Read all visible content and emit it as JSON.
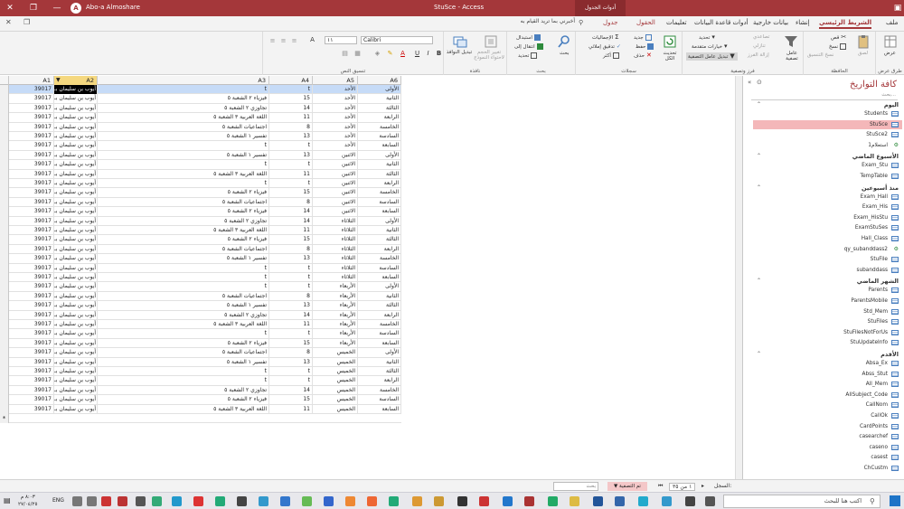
{
  "title": {
    "user": "Abo-a Almoshare",
    "document": "StuSce - Access",
    "context_tab": "أدوات الجدول"
  },
  "tabs": [
    {
      "label": "ملف"
    },
    {
      "label": "الشريط الرئيسي",
      "active": true
    },
    {
      "label": "إنشاء"
    },
    {
      "label": "بيانات خارجية"
    },
    {
      "label": "أدوات قاعدة البيانات"
    },
    {
      "label": "تعليمات"
    },
    {
      "label": "الحقول",
      "context": true
    },
    {
      "label": "جدول",
      "context": true
    }
  ],
  "tell_me": "أخبرني بما تريد القيام به",
  "ribbon": {
    "views": {
      "label": "طرق عرض",
      "view_btn": "عرض"
    },
    "clipboard": {
      "label": "الحافظة",
      "paste": "لصق",
      "cut": "قص",
      "copy": "نسخ",
      "format_painter": "نسخ التنسيق"
    },
    "sort_filter": {
      "label": "فرز وتصفية",
      "filter": "عامل تصفية",
      "ascending": "تصاعدي",
      "descending": "تنازلي",
      "remove_sort": "إزالة الفرز",
      "selection": "تحديد",
      "advanced": "خيارات متقدمة",
      "toggle_filter": "تبديل عامل التصفية"
    },
    "records": {
      "label": "سجلات",
      "refresh": "تحديث الكل",
      "new": "جديد",
      "save": "حفظ",
      "delete": "حذف",
      "totals": "الإجماليات",
      "spelling": "تدقيق إملائي",
      "more": "أكثر"
    },
    "find": {
      "label": "بحث",
      "find": "بحث",
      "replace": "استبدال",
      "goto": "انتقال إلى",
      "select": "تحديد"
    },
    "window": {
      "label": "نافذة",
      "size_to_fit": "تغيير الحجم لاحتواء النموذج",
      "switch_windows": "تبديل النوافذ"
    },
    "text_format": {
      "label": "تنسيق النص",
      "font": "Calibri",
      "size": "١١"
    }
  },
  "columns": [
    "A1",
    "A2",
    "A3",
    "A4",
    "A5",
    "A6"
  ],
  "rows": [
    {
      "a1": "39017",
      "a2": "أيوب بن سليمان بـ",
      "a3": "t",
      "a4": "t",
      "a5": "الأحد",
      "a6": "الأولى"
    },
    {
      "a1": "39017",
      "a2": "أيوب بن سليمان بـ",
      "a3": "فيزياء ٢ الشعبة ٥",
      "a4": "15",
      "a5": "الأحد",
      "a6": "الثانية"
    },
    {
      "a1": "39017",
      "a2": "أيوب بن سليمان بـ",
      "a3": "تجاوزي ٢ الشعبة ٥",
      "a4": "14",
      "a5": "الأحد",
      "a6": "الثالثة"
    },
    {
      "a1": "39017",
      "a2": "أيوب بن سليمان بـ",
      "a3": "اللغة العربية ٣ الشعبة ٥",
      "a4": "11",
      "a5": "الأحد",
      "a6": "الرابعة"
    },
    {
      "a1": "39017",
      "a2": "أيوب بن سليمان بـ",
      "a3": "اجتماعيات الشعبة ٥",
      "a4": "8",
      "a5": "الأحد",
      "a6": "الخامسة"
    },
    {
      "a1": "39017",
      "a2": "أيوب بن سليمان بـ",
      "a3": "تفسير ١ الشعبة ٥",
      "a4": "13",
      "a5": "الأحد",
      "a6": "السادسة"
    },
    {
      "a1": "39017",
      "a2": "أيوب بن سليمان بـ",
      "a3": "t",
      "a4": "t",
      "a5": "الأحد",
      "a6": "السابعة"
    },
    {
      "a1": "39017",
      "a2": "أيوب بن سليمان بـ",
      "a3": "تفسير ١ الشعبة ٥",
      "a4": "13",
      "a5": "الاثنين",
      "a6": "الأولى"
    },
    {
      "a1": "39017",
      "a2": "أيوب بن سليمان بـ",
      "a3": "t",
      "a4": "t",
      "a5": "الاثنين",
      "a6": "الثانية"
    },
    {
      "a1": "39017",
      "a2": "أيوب بن سليمان بـ",
      "a3": "اللغة العربية ٣ الشعبة ٥",
      "a4": "11",
      "a5": "الاثنين",
      "a6": "الثالثة"
    },
    {
      "a1": "39017",
      "a2": "أيوب بن سليمان بـ",
      "a3": "t",
      "a4": "t",
      "a5": "الاثنين",
      "a6": "الرابعة"
    },
    {
      "a1": "39017",
      "a2": "أيوب بن سليمان بـ",
      "a3": "فيزياء ٢ الشعبة ٥",
      "a4": "15",
      "a5": "الاثنين",
      "a6": "الخامسة"
    },
    {
      "a1": "39017",
      "a2": "أيوب بن سليمان بـ",
      "a3": "اجتماعيات الشعبة ٥",
      "a4": "8",
      "a5": "الاثنين",
      "a6": "السادسة"
    },
    {
      "a1": "39017",
      "a2": "أيوب بن سليمان بـ",
      "a3": "فيزياء ٢ الشعبة ٥",
      "a4": "14",
      "a5": "الاثنين",
      "a6": "السابعة"
    },
    {
      "a1": "39017",
      "a2": "أيوب بن سليمان بـ",
      "a3": "تجاوزي ٢ الشعبة ٥",
      "a4": "14",
      "a5": "الثلاثاء",
      "a6": "الأولى"
    },
    {
      "a1": "39017",
      "a2": "أيوب بن سليمان بـ",
      "a3": "اللغة العربية ٣ الشعبة ٥",
      "a4": "11",
      "a5": "الثلاثاء",
      "a6": "الثانية"
    },
    {
      "a1": "39017",
      "a2": "أيوب بن سليمان بـ",
      "a3": "فيزياء ٢ الشعبة ٥",
      "a4": "15",
      "a5": "الثلاثاء",
      "a6": "الثالثة"
    },
    {
      "a1": "39017",
      "a2": "أيوب بن سليمان بـ",
      "a3": "اجتماعيات الشعبة ٥",
      "a4": "8",
      "a5": "الثلاثاء",
      "a6": "الرابعة"
    },
    {
      "a1": "39017",
      "a2": "أيوب بن سليمان بـ",
      "a3": "تفسير ١ الشعبة ٥",
      "a4": "13",
      "a5": "الثلاثاء",
      "a6": "الخامسة"
    },
    {
      "a1": "39017",
      "a2": "أيوب بن سليمان بـ",
      "a3": "t",
      "a4": "t",
      "a5": "الثلاثاء",
      "a6": "السادسة"
    },
    {
      "a1": "39017",
      "a2": "أيوب بن سليمان بـ",
      "a3": "t",
      "a4": "t",
      "a5": "الثلاثاء",
      "a6": "السابعة"
    },
    {
      "a1": "39017",
      "a2": "أيوب بن سليمان بـ",
      "a3": "t",
      "a4": "t",
      "a5": "الأربعاء",
      "a6": "الأولى"
    },
    {
      "a1": "39017",
      "a2": "أيوب بن سليمان بـ",
      "a3": "اجتماعيات الشعبة ٥",
      "a4": "8",
      "a5": "الأربعاء",
      "a6": "الثانية"
    },
    {
      "a1": "39017",
      "a2": "أيوب بن سليمان بـ",
      "a3": "تفسير ١ الشعبة ٥",
      "a4": "13",
      "a5": "الأربعاء",
      "a6": "الثالثة"
    },
    {
      "a1": "39017",
      "a2": "أيوب بن سليمان بـ",
      "a3": "تجاوزي ٢ الشعبة ٥",
      "a4": "14",
      "a5": "الأربعاء",
      "a6": "الرابعة"
    },
    {
      "a1": "39017",
      "a2": "أيوب بن سليمان بـ",
      "a3": "اللغة العربية ٣ الشعبة ٥",
      "a4": "11",
      "a5": "الأربعاء",
      "a6": "الخامسة"
    },
    {
      "a1": "39017",
      "a2": "أيوب بن سليمان بـ",
      "a3": "t",
      "a4": "t",
      "a5": "الأربعاء",
      "a6": "السادسة"
    },
    {
      "a1": "39017",
      "a2": "أيوب بن سليمان بـ",
      "a3": "فيزياء ٢ الشعبة ٥",
      "a4": "15",
      "a5": "الأربعاء",
      "a6": "السابعة"
    },
    {
      "a1": "39017",
      "a2": "أيوب بن سليمان بـ",
      "a3": "اجتماعيات الشعبة ٥",
      "a4": "8",
      "a5": "الخميس",
      "a6": "الأولى"
    },
    {
      "a1": "39017",
      "a2": "أيوب بن سليمان بـ",
      "a3": "تفسير ١ الشعبة ٥",
      "a4": "13",
      "a5": "الخميس",
      "a6": "الثانية"
    },
    {
      "a1": "39017",
      "a2": "أيوب بن سليمان بـ",
      "a3": "t",
      "a4": "t",
      "a5": "الخميس",
      "a6": "الثالثة"
    },
    {
      "a1": "39017",
      "a2": "أيوب بن سليمان بـ",
      "a3": "t",
      "a4": "t",
      "a5": "الخميس",
      "a6": "الرابعة"
    },
    {
      "a1": "39017",
      "a2": "أيوب بن سليمان بـ",
      "a3": "تجاوزي ٢ الشعبة ٥",
      "a4": "14",
      "a5": "الخميس",
      "a6": "الخامسة"
    },
    {
      "a1": "39017",
      "a2": "أيوب بن سليمان بـ",
      "a3": "فيزياء ٢ الشعبة ٥",
      "a4": "15",
      "a5": "الخميس",
      "a6": "السادسة"
    },
    {
      "a1": "39017",
      "a2": "أيوب بن سليمان بـ",
      "a3": "اللغة العربية ٣ الشعبة ٥",
      "a4": "11",
      "a5": "الخميس",
      "a6": "السابعة"
    }
  ],
  "nav": {
    "title": "كافة التواريخ",
    "search_placeholder": "بحث...",
    "groups": [
      {
        "label": "اليوم",
        "items": [
          {
            "name": "Students",
            "type": "table"
          },
          {
            "name": "StuSce",
            "type": "table",
            "selected": true
          },
          {
            "name": "StuSce2",
            "type": "table"
          },
          {
            "name": "استعلام1",
            "type": "query"
          }
        ]
      },
      {
        "label": "الأسبوع الماضي",
        "items": [
          {
            "name": "Exam_Stu",
            "type": "table"
          },
          {
            "name": "TempTable",
            "type": "table"
          }
        ]
      },
      {
        "label": "منذ أسبوعين",
        "items": [
          {
            "name": "Exam_Hall",
            "type": "table"
          },
          {
            "name": "Exam_His",
            "type": "table"
          },
          {
            "name": "Exam_HisStu",
            "type": "table"
          },
          {
            "name": "ExamStuSes",
            "type": "table"
          },
          {
            "name": "Hall_Class",
            "type": "table"
          },
          {
            "name": "qy_subanddass2",
            "type": "query"
          },
          {
            "name": "StuFile",
            "type": "table"
          },
          {
            "name": "subanddass",
            "type": "table"
          }
        ]
      },
      {
        "label": "الشهر الماضي",
        "items": [
          {
            "name": "Parents",
            "type": "table"
          },
          {
            "name": "ParentsMobile",
            "type": "table"
          },
          {
            "name": "Std_Mem",
            "type": "table"
          },
          {
            "name": "StuFiles",
            "type": "table"
          },
          {
            "name": "StuFilesNotForUs",
            "type": "table"
          },
          {
            "name": "StuUpdateInfo",
            "type": "table"
          }
        ]
      },
      {
        "label": "الأقدم",
        "items": [
          {
            "name": "Absa_Ex",
            "type": "table"
          },
          {
            "name": "Abss_Stut",
            "type": "table"
          },
          {
            "name": "All_Mem",
            "type": "table"
          },
          {
            "name": "AllSubject_Code",
            "type": "table"
          },
          {
            "name": "CallNom",
            "type": "table"
          },
          {
            "name": "CallOk",
            "type": "table"
          },
          {
            "name": "CardPoints",
            "type": "table"
          },
          {
            "name": "casearchef",
            "type": "table"
          },
          {
            "name": "caseno",
            "type": "table"
          },
          {
            "name": "casest",
            "type": "table"
          },
          {
            "name": "ChCustm",
            "type": "table"
          }
        ]
      }
    ]
  },
  "status": {
    "record_label": "السجل:",
    "record_value": "١ من ٣٥",
    "filter_badge": "تم التصفية",
    "search_label": "بحث"
  },
  "taskbar": {
    "search_placeholder": "اكتب هنا للبحث",
    "time": "٨:٠٣ م",
    "date": "٢٧/٠٤/٢٥",
    "lang": "ENG"
  },
  "colors": {
    "accent": "#a4373a",
    "selection": "#c6dbf7",
    "nav_selected": "#f4b7b9"
  }
}
